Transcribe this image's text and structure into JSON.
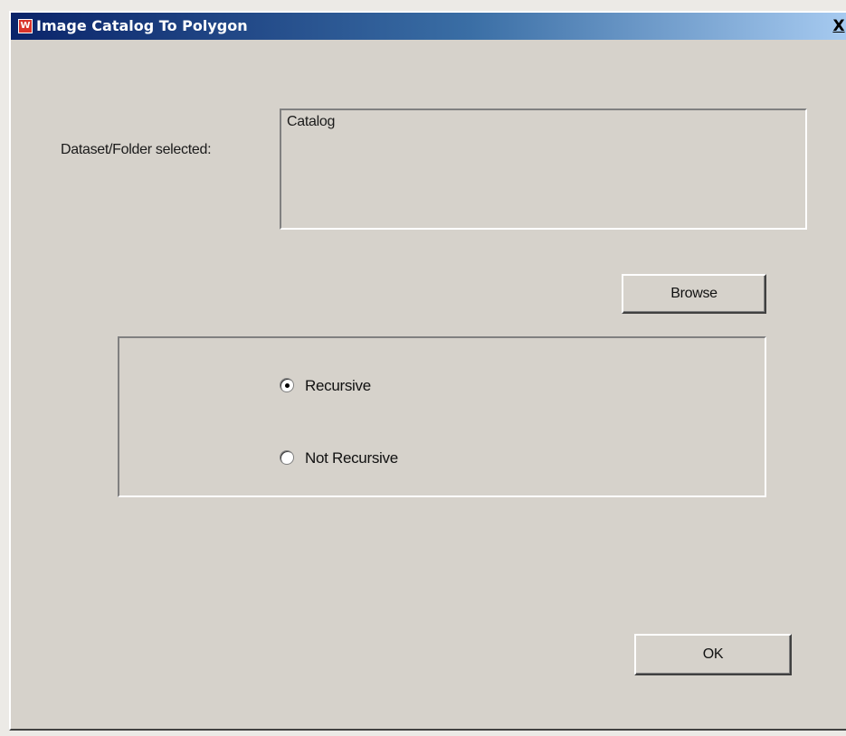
{
  "window": {
    "title": "Image Catalog To Polygon",
    "app_icon_glyph": "W",
    "close_glyph": "X"
  },
  "dataset": {
    "label": "Dataset/Folder selected:",
    "value": "Catalog"
  },
  "buttons": {
    "browse_label": "Browse",
    "ok_label": "OK"
  },
  "options": [
    {
      "label": "Recursive",
      "selected": true
    },
    {
      "label": "Not Recursive",
      "selected": false
    }
  ],
  "colors": {
    "dialog_background": "#d6d2cb",
    "titlebar_start": "#0a246a",
    "titlebar_end": "#a6caf0",
    "app_icon": "#d9342b"
  }
}
